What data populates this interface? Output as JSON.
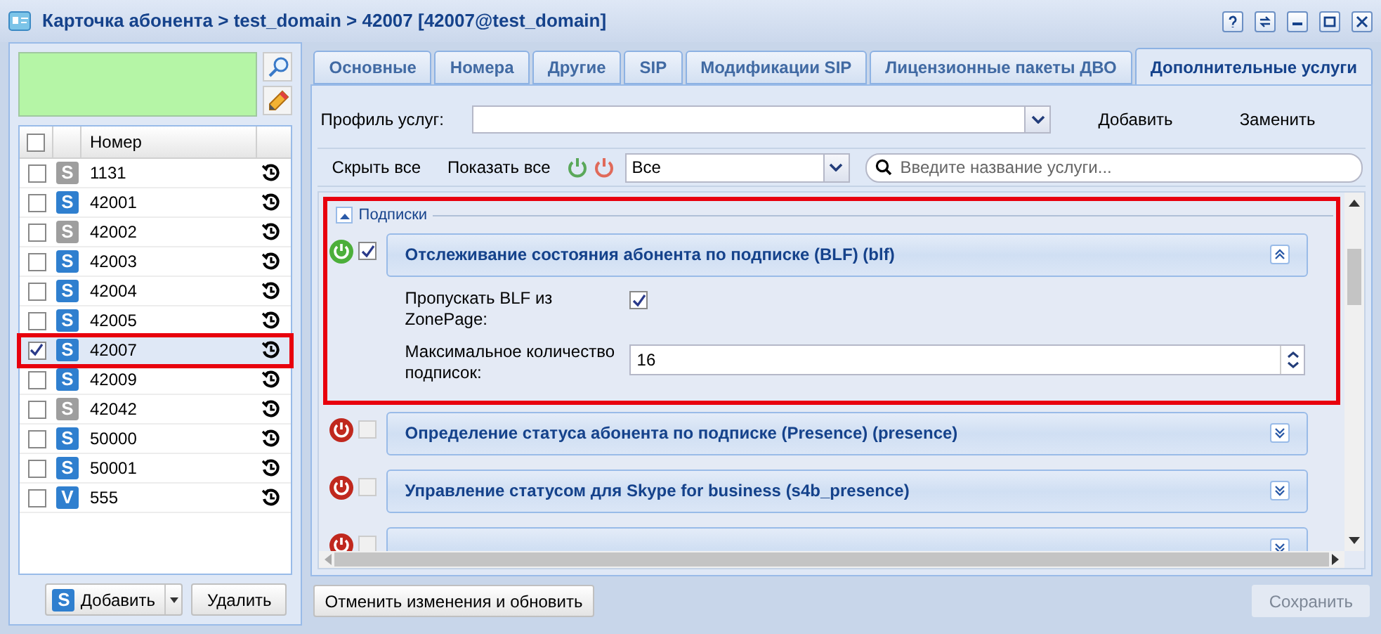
{
  "window": {
    "title": "Карточка абонента > test_domain > 42007 [42007@test_domain]"
  },
  "numbers": {
    "column": "Номер",
    "all_checked": false,
    "rows": [
      {
        "badge": "S",
        "color": "#9e9e9e",
        "number": "1131",
        "checked": false,
        "highlight": false
      },
      {
        "badge": "S",
        "color": "#2f7fcf",
        "number": "42001",
        "checked": false,
        "highlight": false
      },
      {
        "badge": "S",
        "color": "#9e9e9e",
        "number": "42002",
        "checked": false,
        "highlight": false
      },
      {
        "badge": "S",
        "color": "#2f7fcf",
        "number": "42003",
        "checked": false,
        "highlight": false
      },
      {
        "badge": "S",
        "color": "#2f7fcf",
        "number": "42004",
        "checked": false,
        "highlight": false
      },
      {
        "badge": "S",
        "color": "#2f7fcf",
        "number": "42005",
        "checked": false,
        "highlight": false
      },
      {
        "badge": "S",
        "color": "#2f7fcf",
        "number": "42007",
        "checked": true,
        "highlight": true
      },
      {
        "badge": "S",
        "color": "#2f7fcf",
        "number": "42009",
        "checked": false,
        "highlight": false
      },
      {
        "badge": "S",
        "color": "#9e9e9e",
        "number": "42042",
        "checked": false,
        "highlight": false
      },
      {
        "badge": "S",
        "color": "#2f7fcf",
        "number": "50000",
        "checked": false,
        "highlight": false
      },
      {
        "badge": "S",
        "color": "#2f7fcf",
        "number": "50001",
        "checked": false,
        "highlight": false
      },
      {
        "badge": "V",
        "color": "#2f7fcf",
        "number": "555",
        "checked": false,
        "highlight": false
      }
    ],
    "add_badge": "S",
    "add": "Добавить",
    "delete": "Удалить"
  },
  "tabs": [
    {
      "label": "Основные",
      "selected": false
    },
    {
      "label": "Номера",
      "selected": false
    },
    {
      "label": "Другие",
      "selected": false
    },
    {
      "label": "SIP",
      "selected": false
    },
    {
      "label": "Модификации SIP",
      "selected": false
    },
    {
      "label": "Лицензионные пакеты ДВО",
      "selected": false
    },
    {
      "label": "Дополнительные услуги",
      "selected": true
    }
  ],
  "profile": {
    "label": "Профиль услуг:",
    "add": "Добавить",
    "replace": "Заменить"
  },
  "toolbar": {
    "hide_all": "Скрыть все",
    "show_all": "Показать все",
    "filter": "Все",
    "search_placeholder": "Введите название услуги..."
  },
  "group": {
    "title": "Подписки",
    "expanded": true,
    "highlight": true,
    "services": [
      {
        "title": "Отслеживание состояния абонента по подписке (BLF) (blf)",
        "enabled": true,
        "checked": true,
        "expanded": true,
        "fields": [
          {
            "kind": "checkbox",
            "label": "Пропускать BLF из ZonePage:",
            "checked": true
          },
          {
            "kind": "spinner",
            "label": "Максимальное количество подписок:",
            "value": "16"
          }
        ]
      },
      {
        "title": "Определение статуса абонента по подписке (Presence) (presence)",
        "enabled": false,
        "checked": false,
        "expanded": false
      },
      {
        "title": "Управление статусом для Skype for business (s4b_presence)",
        "enabled": false,
        "checked": false,
        "expanded": false
      },
      {
        "enabled": false,
        "checked": false,
        "expanded": false
      }
    ]
  },
  "footer": {
    "revert": "Отменить изменения и обновить",
    "save": "Сохранить",
    "save_disabled": true
  }
}
